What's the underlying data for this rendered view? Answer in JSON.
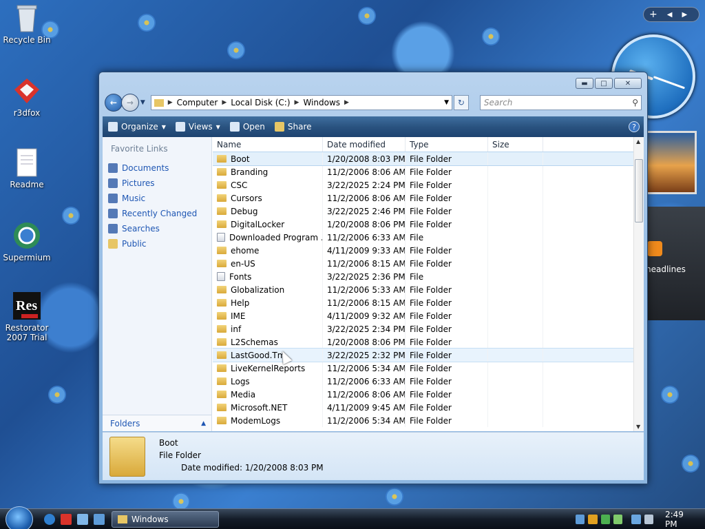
{
  "desktop": {
    "icons": [
      {
        "label": "Recycle Bin"
      },
      {
        "label": "r3dfox"
      },
      {
        "label": "Readme"
      },
      {
        "label": "Supermium"
      },
      {
        "label": "Restorator 2007 Trial"
      }
    ],
    "feed_gadget_text": "headlines"
  },
  "window": {
    "breadcrumb": [
      "Computer",
      "Local Disk (C:)",
      "Windows"
    ],
    "search_placeholder": "Search",
    "toolbar": {
      "organize": "Organize",
      "views": "Views",
      "open": "Open",
      "share": "Share"
    },
    "left_pane": {
      "title": "Favorite Links",
      "links": [
        "Documents",
        "Pictures",
        "Music",
        "Recently Changed",
        "Searches",
        "Public"
      ],
      "folders_label": "Folders"
    },
    "columns": [
      "Name",
      "Date modified",
      "Type",
      "Size"
    ],
    "rows": [
      {
        "name": "Boot",
        "date": "1/20/2008 8:03 PM",
        "type": "File Folder",
        "icon": "folder",
        "state": "selected"
      },
      {
        "name": "Branding",
        "date": "11/2/2006 8:06 AM",
        "type": "File Folder",
        "icon": "folder"
      },
      {
        "name": "CSC",
        "date": "3/22/2025 2:24 PM",
        "type": "File Folder",
        "icon": "folder"
      },
      {
        "name": "Cursors",
        "date": "11/2/2006 8:06 AM",
        "type": "File Folder",
        "icon": "folder"
      },
      {
        "name": "Debug",
        "date": "3/22/2025 2:46 PM",
        "type": "File Folder",
        "icon": "folder"
      },
      {
        "name": "DigitalLocker",
        "date": "1/20/2008 8:06 PM",
        "type": "File Folder",
        "icon": "folder"
      },
      {
        "name": "Downloaded Program ...",
        "date": "11/2/2006 6:33 AM",
        "type": "File",
        "icon": "file"
      },
      {
        "name": "ehome",
        "date": "4/11/2009 9:33 AM",
        "type": "File Folder",
        "icon": "folder"
      },
      {
        "name": "en-US",
        "date": "11/2/2006 8:15 AM",
        "type": "File Folder",
        "icon": "folder"
      },
      {
        "name": "Fonts",
        "date": "3/22/2025 2:36 PM",
        "type": "File",
        "icon": "file"
      },
      {
        "name": "Globalization",
        "date": "11/2/2006 5:33 AM",
        "type": "File Folder",
        "icon": "folder"
      },
      {
        "name": "Help",
        "date": "11/2/2006 8:15 AM",
        "type": "File Folder",
        "icon": "folder"
      },
      {
        "name": "IME",
        "date": "4/11/2009 9:32 AM",
        "type": "File Folder",
        "icon": "folder"
      },
      {
        "name": "inf",
        "date": "3/22/2025 2:34 PM",
        "type": "File Folder",
        "icon": "folder"
      },
      {
        "name": "L2Schemas",
        "date": "1/20/2008 8:06 PM",
        "type": "File Folder",
        "icon": "folder"
      },
      {
        "name": "LastGood.Tm",
        "date": "3/22/2025 2:32 PM",
        "type": "File Folder",
        "icon": "folder",
        "state": "hover"
      },
      {
        "name": "LiveKernelReports",
        "date": "11/2/2006 5:34 AM",
        "type": "File Folder",
        "icon": "folder"
      },
      {
        "name": "Logs",
        "date": "11/2/2006 6:33 AM",
        "type": "File Folder",
        "icon": "folder"
      },
      {
        "name": "Media",
        "date": "11/2/2006 8:06 AM",
        "type": "File Folder",
        "icon": "folder"
      },
      {
        "name": "Microsoft.NET",
        "date": "4/11/2009 9:45 AM",
        "type": "File Folder",
        "icon": "folder"
      },
      {
        "name": "ModemLogs",
        "date": "11/2/2006 5:34 AM",
        "type": "File Folder",
        "icon": "folder"
      }
    ],
    "details": {
      "name": "Boot",
      "type": "File Folder",
      "modified_label": "Date modified:",
      "modified_value": "1/20/2008 8:03 PM"
    }
  },
  "taskbar": {
    "task_label": "Windows",
    "clock": "2:49 PM"
  }
}
